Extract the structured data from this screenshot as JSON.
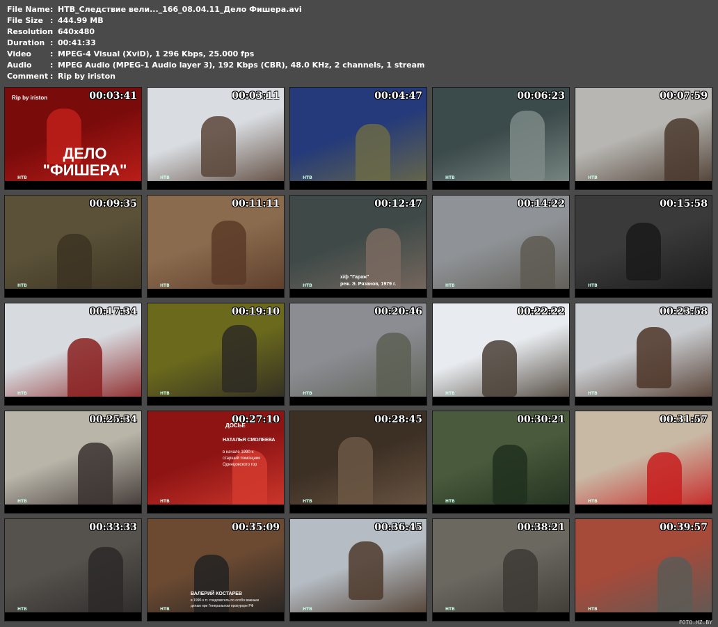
{
  "info": [
    {
      "key": "File Name",
      "value": "НТВ_Следствие вели..._166_08.04.11_Дело Фишера.avi"
    },
    {
      "key": "File Size",
      "value": "444.99 MB"
    },
    {
      "key": "Resolution",
      "value": "640x480"
    },
    {
      "key": "Duration",
      "value": "00:41:33"
    },
    {
      "key": "Video",
      "value": "MPEG-4 Visual (XviD), 1 296 Kbps, 25.000 fps"
    },
    {
      "key": "Audio",
      "value": "MPEG Audio (MPEG-1 Audio layer 3), 192 Kbps (CBR), 48.0 KHz, 2 channels, 1 stream"
    },
    {
      "key": "Comment",
      "value": "Rip by iriston"
    }
  ],
  "separator": ":",
  "thumbnails": [
    {
      "time": "00:03:41",
      "bg": "#7a0b0b",
      "fg": "#c0201a"
    },
    {
      "time": "00:03:11",
      "bg": "#d9dde2",
      "fg": "#5a4538"
    },
    {
      "time": "00:04:47",
      "bg": "#243a7a",
      "fg": "#6b6a46"
    },
    {
      "time": "00:06:23",
      "bg": "#3b4a4a",
      "fg": "#7d8a86"
    },
    {
      "time": "00:07:59",
      "bg": "#b7b6b2",
      "fg": "#4b3a2e"
    },
    {
      "time": "00:09:35",
      "bg": "#5a5138",
      "fg": "#3c3322"
    },
    {
      "time": "00:11:11",
      "bg": "#8b6b4e",
      "fg": "#5a3b28"
    },
    {
      "time": "00:12:47",
      "bg": "#3f4a48",
      "fg": "#7a6a60"
    },
    {
      "time": "00:14:22",
      "bg": "#8f9397",
      "fg": "#5e5a52"
    },
    {
      "time": "00:15:58",
      "bg": "#3a3a3a",
      "fg": "#1a1a1a"
    },
    {
      "time": "00:17:34",
      "bg": "#d7dbe0",
      "fg": "#8a2020"
    },
    {
      "time": "00:19:10",
      "bg": "#6b6a1c",
      "fg": "#2e2a24"
    },
    {
      "time": "00:20:46",
      "bg": "#8b8d93",
      "fg": "#5c5f52"
    },
    {
      "time": "00:22:22",
      "bg": "#e8ecf0",
      "fg": "#4a4036"
    },
    {
      "time": "00:23:58",
      "bg": "#c9ccd0",
      "fg": "#4d3528"
    },
    {
      "time": "00:25:34",
      "bg": "#b9b5a9",
      "fg": "#3a3230"
    },
    {
      "time": "00:27:10",
      "bg": "#8e1414",
      "fg": "#d23a2e"
    },
    {
      "time": "00:28:45",
      "bg": "#3c2f24",
      "fg": "#6c5744"
    },
    {
      "time": "00:30:21",
      "bg": "#4a5a3c",
      "fg": "#20301e"
    },
    {
      "time": "00:31:57",
      "bg": "#c8b9a5",
      "fg": "#c71e1e"
    },
    {
      "time": "00:33:33",
      "bg": "#55524d",
      "fg": "#2b2928"
    },
    {
      "time": "00:35:09",
      "bg": "#6c4a32",
      "fg": "#222"
    },
    {
      "time": "00:36:45",
      "bg": "#b5bcc3",
      "fg": "#4d3a2c"
    },
    {
      "time": "00:38:21",
      "bg": "#6b6860",
      "fg": "#3d3a35"
    },
    {
      "time": "00:39:57",
      "bg": "#a64a3a",
      "fg": "#5c5a56"
    }
  ],
  "thumb_texts": {
    "t0_corner": "Rip by iriston",
    "t0_title_line1": "ДЕЛО",
    "t0_title_line2": "\"ФИШЕРА\"",
    "t7_caption_line1": "х/ф \"Гараж\"",
    "t7_caption_line2": "реж. Э. Рязанов, 1979 г.",
    "t16_header": "ДОСЬЕ",
    "t16_name": "НАТАЛЬЯ СМОЛЕЕВА",
    "t16_desc_line1": "в начале 1990-х",
    "t16_desc_line2": "старший помощник",
    "t16_desc_line3": "Одинцовского гор",
    "t21_name": "ВАЛЕРИЙ КОСТАРЕВ",
    "t21_desc_line1": "в 1990-х гг. следователь по особо важным",
    "t21_desc_line2": "делам при Генеральном прокуроре РФ",
    "ntv": "НТВ"
  },
  "watermark": "FOTO.HZ.BY"
}
